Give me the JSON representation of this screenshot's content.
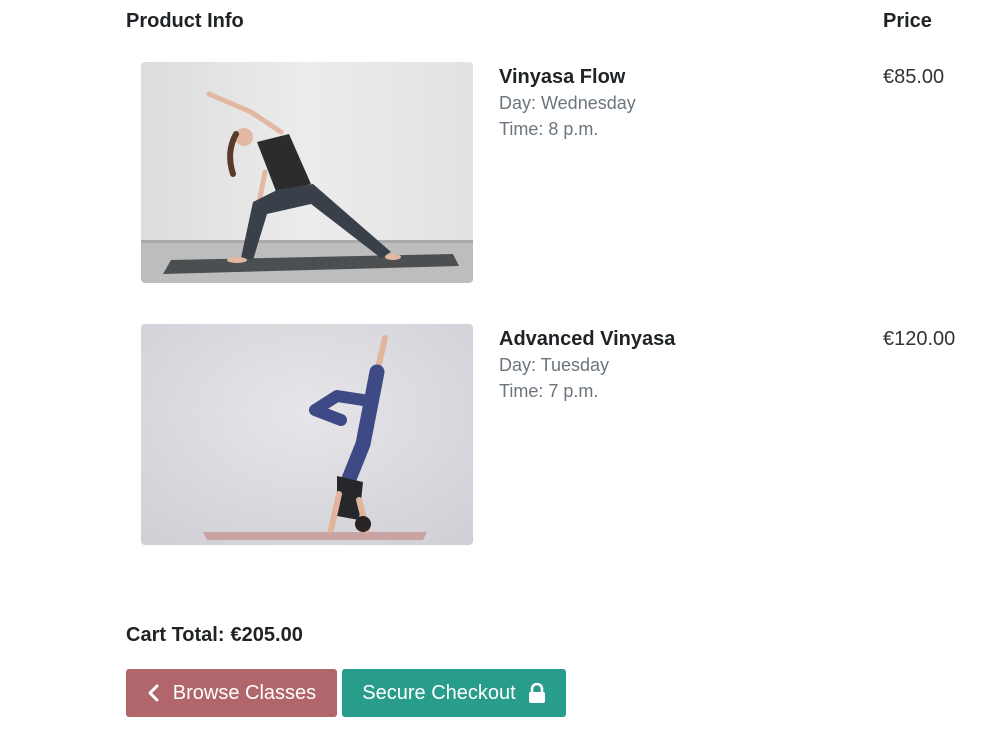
{
  "table": {
    "header_product": "Product Info",
    "header_price": "Price"
  },
  "items": [
    {
      "name": "Vinyasa Flow",
      "day": "Day: Wednesday",
      "time": "Time: 8 p.m.",
      "price": "€85.00"
    },
    {
      "name": "Advanced Vinyasa",
      "day": "Day: Tuesday",
      "time": "Time: 7 p.m.",
      "price": "€120.00"
    }
  ],
  "cart": {
    "total_label": "Cart Total:",
    "total_amount": "€205.00"
  },
  "actions": {
    "browse_label": "Browse Classes",
    "browse_icon": "chevron-left-icon",
    "checkout_label": "Secure Checkout",
    "checkout_icon": "lock-icon"
  },
  "colors": {
    "browse_button": "#b0666b",
    "checkout_button": "#299d8c"
  }
}
